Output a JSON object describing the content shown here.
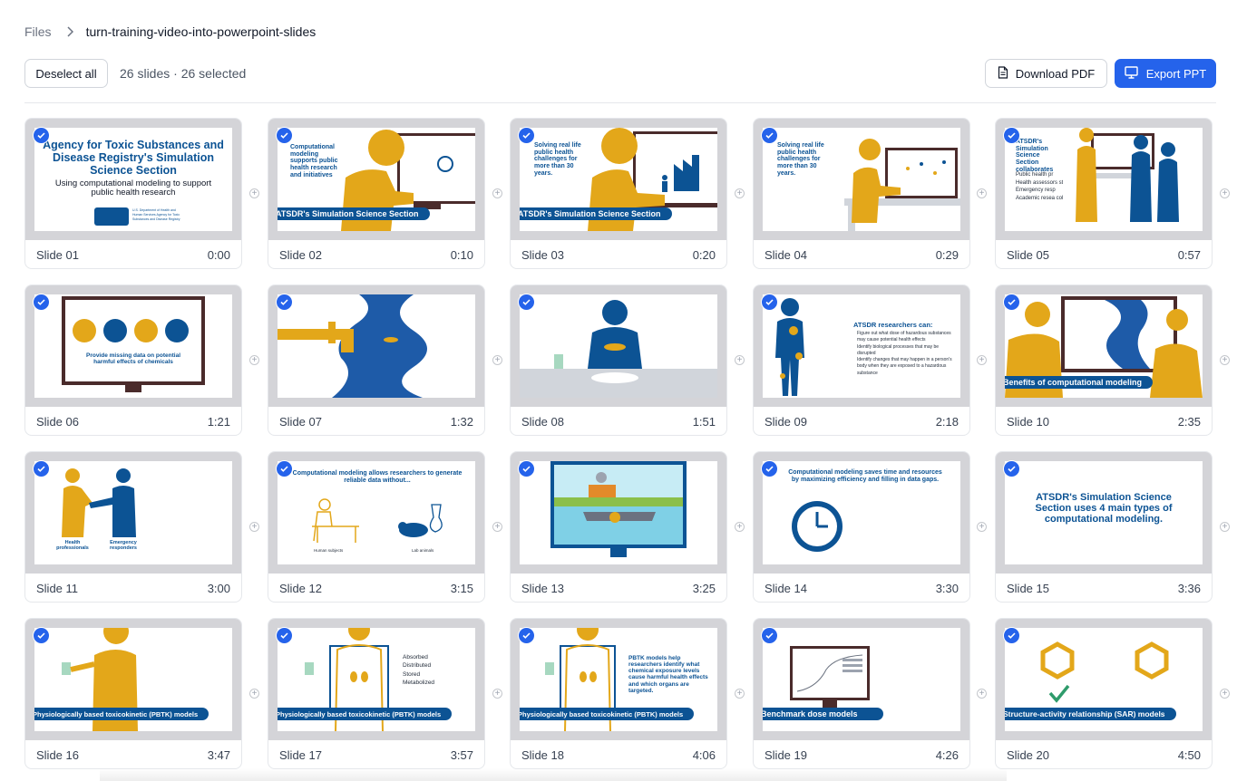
{
  "breadcrumb": {
    "root": "Files",
    "current": "turn-training-video-into-powerpoint-slides"
  },
  "toolbar": {
    "deselect_label": "Deselect all",
    "count_text": "26 slides · 26 selected",
    "pdf_label": "Download PDF",
    "ppt_label": "Export PPT"
  },
  "colors": {
    "accent": "#2563eb",
    "atsdr_blue": "#0c5394",
    "figure_gold": "#e3a71a"
  },
  "slides": [
    {
      "name": "Slide 01",
      "time": "0:00",
      "texts": {
        "title": "Agency for Toxic Substances and Disease Registry's Simulation Science Section",
        "subtitle": "Using computational modeling to support public health research",
        "logo": "U.S. Department of Health and Human Services Agency for Toxic Substances and Disease Registry"
      }
    },
    {
      "name": "Slide 02",
      "time": "0:10",
      "texts": {
        "body": "Computational modeling supports public health research and initiatives",
        "banner": "ATSDR's Simulation Science Section"
      }
    },
    {
      "name": "Slide 03",
      "time": "0:20",
      "texts": {
        "body": "Solving real life public health challenges for more than 30 years.",
        "banner": "ATSDR's Simulation Science Section"
      }
    },
    {
      "name": "Slide 04",
      "time": "0:29",
      "texts": {
        "body": "Solving real life public health challenges for more than 30 years."
      }
    },
    {
      "name": "Slide 05",
      "time": "0:57",
      "texts": {
        "title": "ATSDR's Simulation Science Section collaborates",
        "b1": "Public health pr",
        "b2": "Health assessors state health dep",
        "b3": "Emergency resp",
        "b4": "Academic resea colleges and un"
      }
    },
    {
      "name": "Slide 06",
      "time": "1:21",
      "texts": {
        "caption": "Provide missing data on potential harmful effects of chemicals"
      }
    },
    {
      "name": "Slide 07",
      "time": "1:32",
      "texts": {}
    },
    {
      "name": "Slide 08",
      "time": "1:51",
      "texts": {}
    },
    {
      "name": "Slide 09",
      "time": "2:18",
      "texts": {
        "title": "ATSDR researchers can:",
        "b1": "Figure out what dose of hazardous substances may cause potential health effects",
        "b2": "Identify biological processes that may be disrupted",
        "b3": "Identify changes that may happen in a person's body when they are exposed to a hazardous substance"
      }
    },
    {
      "name": "Slide 10",
      "time": "2:35",
      "texts": {
        "banner": "Benefits of computational modeling"
      }
    },
    {
      "name": "Slide 11",
      "time": "3:00",
      "texts": {
        "l1": "Health professionals",
        "l2": "Emergency responders"
      }
    },
    {
      "name": "Slide 12",
      "time": "3:15",
      "texts": {
        "title": "Computational modeling allows researchers to generate reliable data without...",
        "l1": "Human subjects",
        "l2": "Lab animals"
      }
    },
    {
      "name": "Slide 13",
      "time": "3:25",
      "texts": {}
    },
    {
      "name": "Slide 14",
      "time": "3:30",
      "texts": {
        "title": "Computational modeling saves time and resources by maximizing efficiency and filling in data gaps."
      }
    },
    {
      "name": "Slide 15",
      "time": "3:36",
      "texts": {
        "title": "ATSDR's Simulation Science Section uses 4 main types of computational modeling."
      }
    },
    {
      "name": "Slide 16",
      "time": "3:47",
      "texts": {
        "banner": "Physiologically based toxicokinetic (PBTK) models"
      }
    },
    {
      "name": "Slide 17",
      "time": "3:57",
      "texts": {
        "b1": "Absorbed",
        "b2": "Distributed",
        "b3": "Stored",
        "b4": "Metabolized",
        "banner": "Physiologically based toxicokinetic (PBTK) models"
      }
    },
    {
      "name": "Slide 18",
      "time": "4:06",
      "texts": {
        "body": "PBTK models help researchers identify what chemical exposure levels cause harmful health effects and which organs are targeted.",
        "banner": "Physiologically based toxicokinetic (PBTK) models"
      }
    },
    {
      "name": "Slide 19",
      "time": "4:26",
      "texts": {
        "banner": "Benchmark dose models"
      }
    },
    {
      "name": "Slide 20",
      "time": "4:50",
      "texts": {
        "banner": "Structure-activity relationship (SAR) models"
      }
    }
  ]
}
